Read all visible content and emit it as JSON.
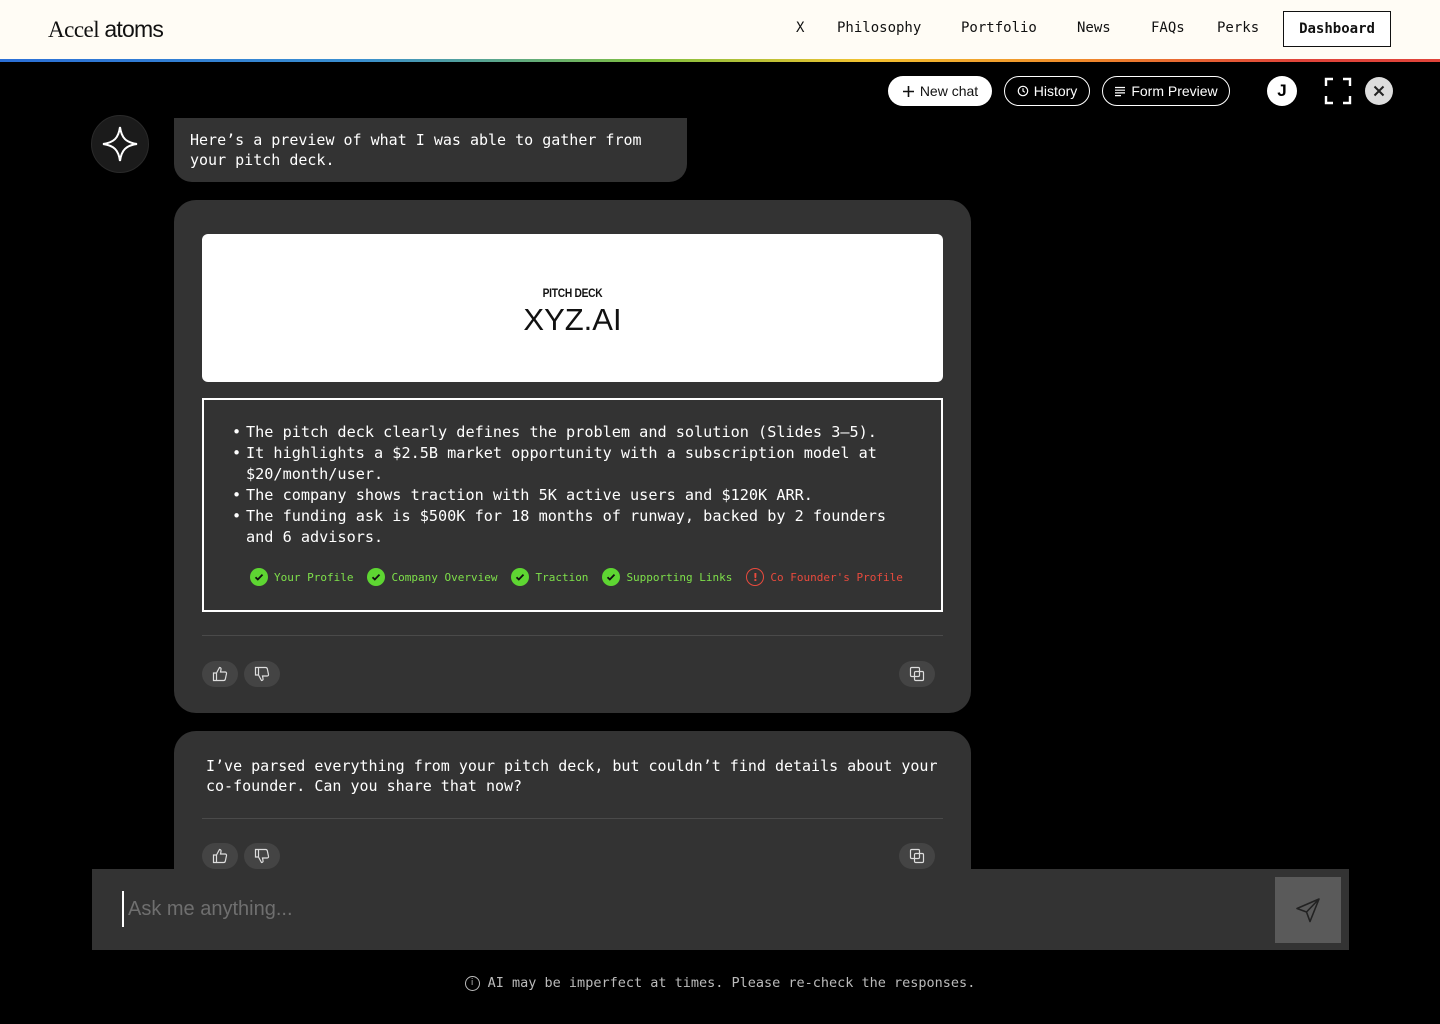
{
  "nav": {
    "logo_light": "Accel",
    "logo_bold": "atoms",
    "links": [
      "X",
      "Philosophy",
      "Portfolio",
      "News",
      "FAQs",
      "Perks"
    ],
    "dashboard_label": "Dashboard"
  },
  "toolbar": {
    "new_chat_label": "New chat",
    "history_label": "History",
    "form_preview_label": "Form Preview",
    "avatar_initial": "J"
  },
  "messages": {
    "intro": "Here’s a preview of what I was able to gather from your pitch deck.",
    "deck_label": "PITCH DECK",
    "deck_title": "XYZ.AI",
    "bullets": [
      "The pitch deck clearly defines the problem and solution (Slides 3–5).",
      "It highlights a $2.5B market opportunity with a subscription model at $20/month/user.",
      "The company shows traction with 5K active users and $120K ARR.",
      "The funding ask is $500K for 18 months of runway, backed by 2 founders and 6 advisors."
    ],
    "checks": [
      {
        "label": "Your Profile",
        "status": "done"
      },
      {
        "label": "Company Overview",
        "status": "done"
      },
      {
        "label": "Traction",
        "status": "done"
      },
      {
        "label": "Supporting Links",
        "status": "done"
      },
      {
        "label": "Co Founder's Profile",
        "status": "missing"
      }
    ],
    "followup": "I’ve parsed everything from your pitch deck, but couldn’t find details about your co-founder. Can you share that now?"
  },
  "input": {
    "placeholder": "Ask me anything..."
  },
  "disclaimer": "AI may be imperfect at times. Please re-check the responses.",
  "colors": {
    "success": "#5ed632",
    "warning": "#e84a3d",
    "surface": "#333333",
    "background": "#000000"
  }
}
